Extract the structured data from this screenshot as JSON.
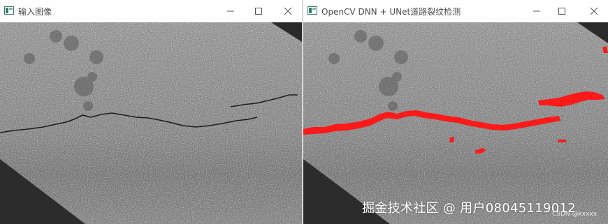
{
  "left_window": {
    "title": "输入图像",
    "icon": "opencv-app-icon",
    "controls": [
      "minimize",
      "maximize",
      "close"
    ]
  },
  "right_window": {
    "title": "OpenCV DNN + UNet道路裂纹检测",
    "icon": "opencv-app-icon",
    "controls": [
      "minimize",
      "maximize",
      "close"
    ]
  },
  "overlay": {
    "watermark": "掘金技术社区 @ 用户08045119012",
    "small_watermark": "CSDN @kxxxx"
  },
  "colors": {
    "road_gray": "#8e8e8e",
    "dark_corner": "#2a2a2a",
    "crack_mask": "#ff1a1a",
    "titlebar_text": "#4a4a4a"
  }
}
